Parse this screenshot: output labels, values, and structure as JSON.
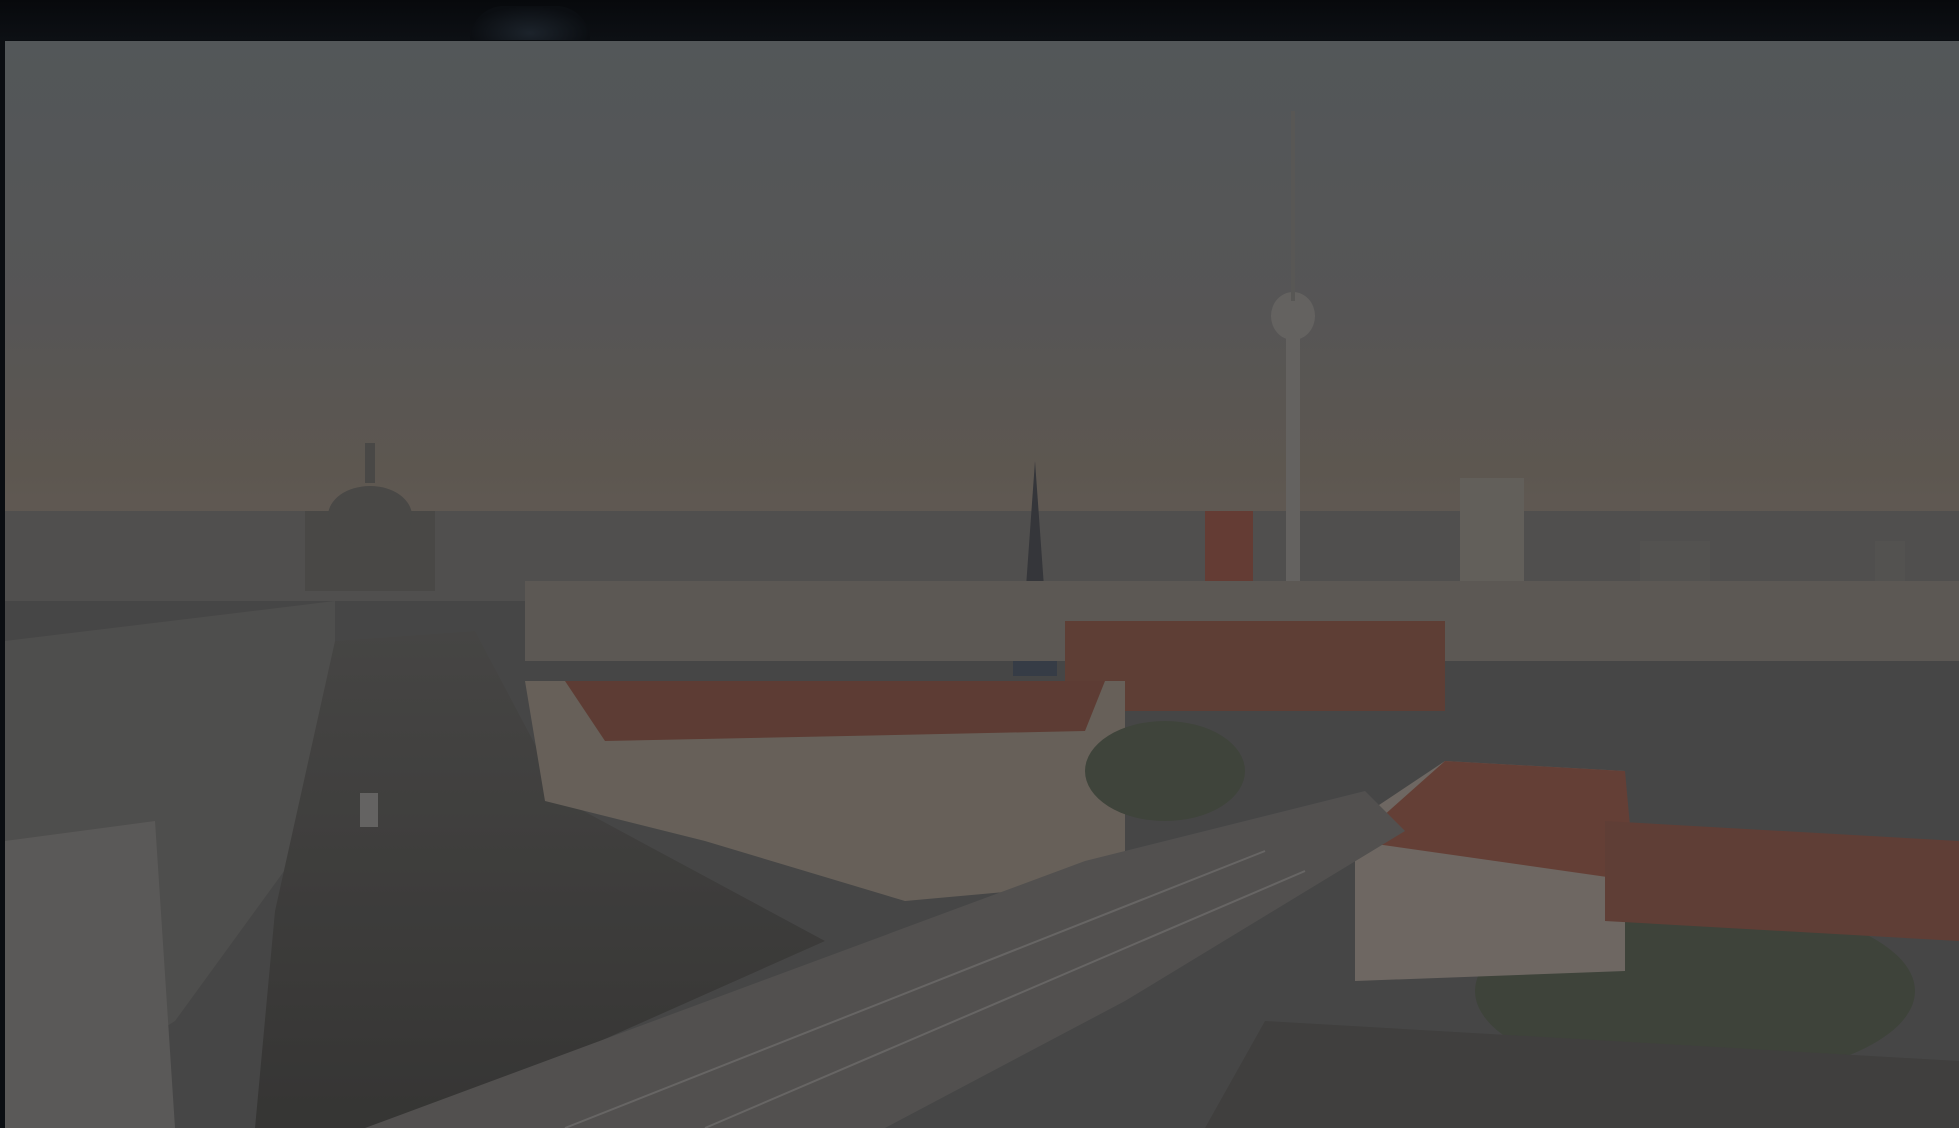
{
  "header": {
    "status_text": ""
  },
  "viewer": {
    "image_label": "",
    "overlay_dimmed": true
  },
  "icons": {
    "dim_overlay": "dim-overlay"
  },
  "colors": {
    "top_bar": "#0b0e12",
    "sky": "#6b7276",
    "river": "#4a4a48",
    "roofs": "#7a4a3a",
    "overlay": "rgba(40,40,40,0.38)"
  }
}
